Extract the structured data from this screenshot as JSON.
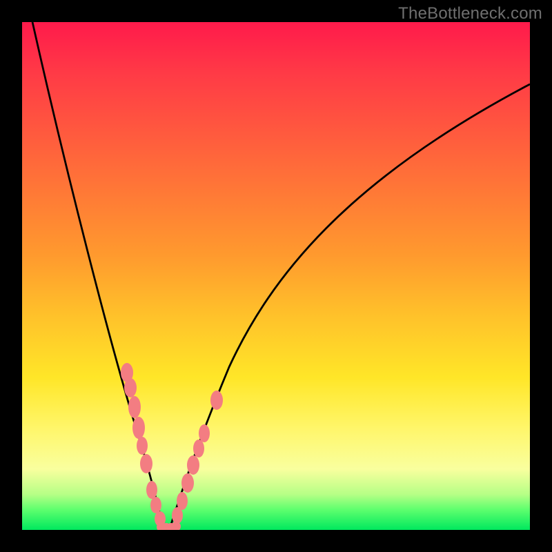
{
  "watermark": {
    "text": "TheBottleneck.com"
  },
  "chart_data": {
    "type": "line",
    "title": "",
    "xlabel": "",
    "ylabel": "",
    "xlim": [
      0,
      100
    ],
    "ylim": [
      0,
      100
    ],
    "grid": false,
    "legend": false,
    "series": [
      {
        "name": "bottleneck-curve",
        "x": [
          2,
          5,
          8,
          11,
          14,
          17,
          19,
          21,
          23,
          25,
          26,
          27,
          28,
          29,
          30,
          32,
          35,
          38,
          42,
          48,
          55,
          62,
          70,
          80,
          90,
          100
        ],
        "y": [
          100,
          88,
          76,
          64,
          52,
          40,
          32,
          24,
          16,
          8,
          4,
          1,
          0,
          1,
          4,
          10,
          18,
          26,
          34,
          44,
          54,
          62,
          70,
          78,
          84,
          88
        ]
      },
      {
        "name": "highlight-dots-left",
        "x": [
          19,
          20,
          21,
          22,
          22.5,
          23,
          25,
          26,
          27
        ],
        "y": [
          31,
          28,
          24,
          20,
          17,
          14,
          8,
          4,
          1
        ]
      },
      {
        "name": "highlight-dots-right",
        "x": [
          29,
          30,
          31,
          32,
          33,
          34,
          36
        ],
        "y": [
          1,
          4,
          8,
          12,
          16,
          20,
          30
        ]
      },
      {
        "name": "bottom-run",
        "x": [
          27,
          27.5,
          28,
          28.5,
          29
        ],
        "y": [
          0,
          0,
          0,
          0,
          0
        ]
      }
    ],
    "colors": {
      "curve": "#000000",
      "dots": "#f37d82",
      "gradient_top": "#ff1a4b",
      "gradient_bottom": "#00e85e"
    }
  }
}
